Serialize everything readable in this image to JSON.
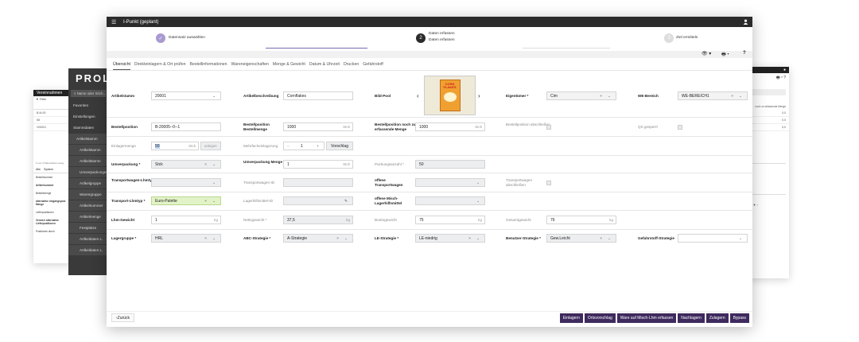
{
  "bg_left": {
    "title": "Vereinnahmen",
    "filter": "Filter",
    "rows": [
      "B-M-00",
      "58",
      "V00001"
    ],
    "footer": "0 von 3 Datensätzen ausg.",
    "tabs": [
      "Alle",
      "System"
    ],
    "labels": [
      "Bestellnummer",
      "Artikelnummer",
      "Bestellmenge",
      "alternative eingangsposi Menge",
      "Lieferpositionen",
      "Vermerr alternative Lieferpositionen",
      "Positionen durch"
    ]
  },
  "prolag": {
    "logo": "PROLA",
    "search_placeholder": "Name oder Stich...",
    "nav": [
      "Favoriten",
      "Einstellungen",
      "Stammdaten",
      "Artikelstamm",
      "Artikelstamm",
      "Artikelstamm",
      "Umverpackungen",
      "Artikelgruppe",
      "Warengruppe",
      "Artikelnummer",
      "Artikelmenge",
      "Festplätze",
      "Artikeldaten L.",
      "Artikeldaten L."
    ]
  },
  "bg_right": {
    "rows": [
      "0,0",
      "0,0",
      "0,0"
    ],
    "col_header": "noch zu erfassende Menge"
  },
  "window": {
    "title": "I-Punkt (geplant)"
  },
  "steps": [
    {
      "label": "Datensatz auswählen",
      "sub": ""
    },
    {
      "num": "2",
      "label": "Daten erfassen",
      "sub": "Daten erfassen"
    },
    {
      "num": "3",
      "label": "Ziel ermitteln",
      "sub": ""
    }
  ],
  "toolbar": {
    "eye": "👁",
    "print": "🖶",
    "help": "?"
  },
  "tabs": [
    "Übersicht",
    "Direkteinlagern & Ort prüfen",
    "Bestellinformationen",
    "Wareneigenschaften",
    "Menge & Gewicht",
    "Datum & Uhrzeit",
    "Drucken",
    "Gefahrstoff"
  ],
  "form": {
    "artikelstamm": {
      "label": "Artikelstamm",
      "value": "20001"
    },
    "artikelbeschreibung": {
      "label": "Artikelbeschreibung",
      "value": "Cornflakes"
    },
    "bildpool": {
      "label": "Bild-Pool",
      "image_text": "CORN FLAKES"
    },
    "eigentuemer": {
      "label": "Eigentümer *",
      "value": "Cim"
    },
    "webereich": {
      "label": "WE-Bereich",
      "value": "WE-BEREICH1"
    },
    "bestellposition": {
      "label": "Bestellposition",
      "value": "B-20005--0--1"
    },
    "bestellmenge": {
      "label": "Bestellposition Bestellmenge",
      "value": "1000",
      "unit": "Stck"
    },
    "nochzuerfassen": {
      "label": "Bestellposition noch zu erfassende Menge",
      "value": "1000",
      "unit": "Stck"
    },
    "abschliessen": {
      "label": "Bestellposition abschließen"
    },
    "qs": {
      "label": "QS gesperrt"
    },
    "einlagermenge": {
      "label": "Einlagermenge",
      "value": "50",
      "unit": "Stck",
      "button": "anlegen"
    },
    "mehrfach": {
      "label": "Mehrfacheinlagerung",
      "value": "1",
      "button": "Vorschlag"
    },
    "umverpackung": {
      "label": "Umverpackung *",
      "value": "Stck"
    },
    "umverpackungmenge": {
      "label": "Umverpackung Menge",
      "value": "1",
      "unit": "Stck"
    },
    "packungsanzahl": {
      "label": "Packungsanzahl *",
      "value": "50"
    },
    "twlhmtyp": {
      "label": "Transportwagen-Lhmtyp",
      "value": ""
    },
    "twid": {
      "label": "Transportwagen-ID",
      "value": ""
    },
    "offenetw": {
      "label": "offene Transportwagen",
      "value": ""
    },
    "twabschliessen": {
      "label": "Transportwagen abschließen"
    },
    "tlhmtyp": {
      "label": "Transport-Lhmtyp *",
      "value": "Euro-Palette"
    },
    "lhmid": {
      "label": "Lagerhilfsmittel-ID",
      "value": ""
    },
    "mischlhm": {
      "label": "offene Misch-Lagerhilfsmittel",
      "value": ""
    },
    "lhmgewicht": {
      "label": "Lhm-Gewicht",
      "value": "1",
      "unit": "kg"
    },
    "netto": {
      "label": "Nettogewicht *",
      "value": "37,5",
      "unit": "kg"
    },
    "brutto": {
      "label": "Bruttogewicht",
      "value": "75",
      "unit": "kg"
    },
    "gesamt": {
      "label": "Gesamtgewicht",
      "value": "76",
      "unit": "kg"
    },
    "lagergruppe": {
      "label": "Lagergruppe *",
      "value": "HRL"
    },
    "abc": {
      "label": "ABC-Strategie *",
      "value": "A-Strategie"
    },
    "le": {
      "label": "LE-Strategie *",
      "value": "LE-niedrig"
    },
    "benutzer": {
      "label": "Benutzer-Strategie *",
      "value": "Gew.Leicht"
    },
    "gefahr": {
      "label": "Gefahrstoff-Strategie",
      "value": ""
    }
  },
  "bottom": {
    "back": "Zurück",
    "actions": [
      "Einlagern",
      "Ortsvorschlag",
      "Ware auf Misch-Lhm erfassen",
      "Nachlagern",
      "Zulagern",
      "Bypass"
    ]
  },
  "colors": {
    "accent": "#3e2a5e",
    "step_done": "#a99ad0",
    "green_field": "#e3f3c8"
  }
}
